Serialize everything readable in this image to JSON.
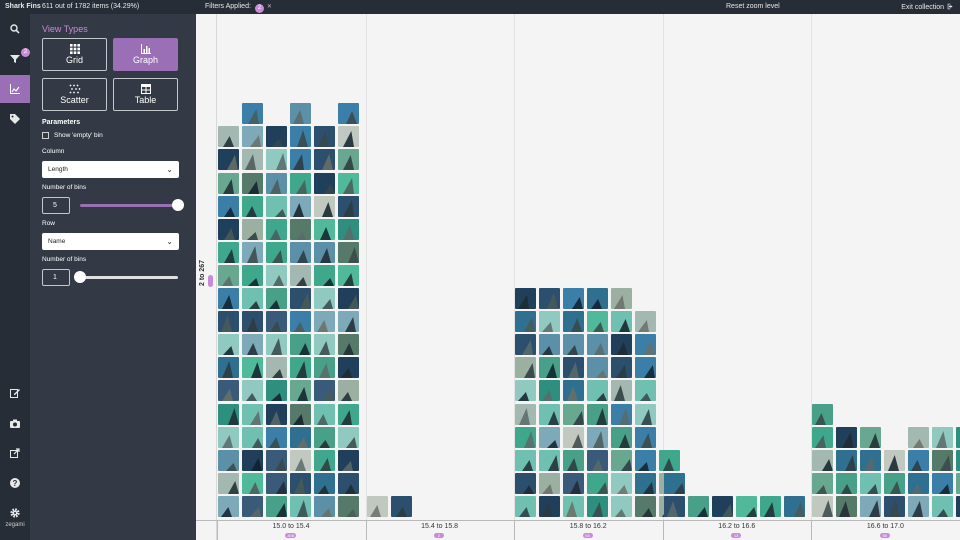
{
  "topbar": {
    "collection_title": "Shark Fins",
    "item_count": "611 out of 1782 items (34.29%)",
    "filters_label": "Filters Applied:",
    "filters_count": "2",
    "reset_zoom": "Reset zoom level",
    "exit_collection": "Exit collection"
  },
  "rail": {
    "filter_badge": "2",
    "brand": "zegami"
  },
  "panel": {
    "heading": "View Types",
    "view_types": [
      {
        "label": "Grid",
        "icon": "grid-icon"
      },
      {
        "label": "Graph",
        "icon": "bar-chart-icon",
        "active": true
      },
      {
        "label": "Scatter",
        "icon": "scatter-icon"
      },
      {
        "label": "Table",
        "icon": "table-icon"
      }
    ],
    "parameters_heading": "Parameters",
    "show_empty_bin": "Show 'empty' bin",
    "column_label": "Column",
    "column_value": "Length",
    "column_bins_label": "Number of bins",
    "column_bins_value": "5",
    "column_bins_fraction": 1.0,
    "row_label": "Row",
    "row_value": "Name",
    "row_bins_label": "Number of bins",
    "row_bins_value": "1",
    "row_bins_fraction": 0.0
  },
  "graph": {
    "row_bin_label": "2 to 267",
    "row_bin_count": "611",
    "colors": {
      "accent": "#9b6fb5",
      "badge": "#c98bd8"
    },
    "bins": [
      {
        "label": "15.0 to 15.4",
        "count": "308",
        "columns": [
          17,
          18,
          17,
          18,
          17,
          18
        ]
      },
      {
        "label": "15.4 to 15.8",
        "count": "2",
        "columns": [
          1,
          1
        ]
      },
      {
        "label": "15.8 to 16.2",
        "count": "93",
        "columns": [
          10,
          10,
          10,
          10,
          10,
          9,
          3
        ]
      },
      {
        "label": "16.2 to 16.6",
        "count": "13",
        "columns": [
          2,
          1,
          1,
          1,
          1,
          1
        ]
      },
      {
        "label": "16.6 to 17.0",
        "count": "55",
        "columns": [
          5,
          4,
          4,
          3,
          4,
          4,
          4
        ]
      }
    ]
  }
}
